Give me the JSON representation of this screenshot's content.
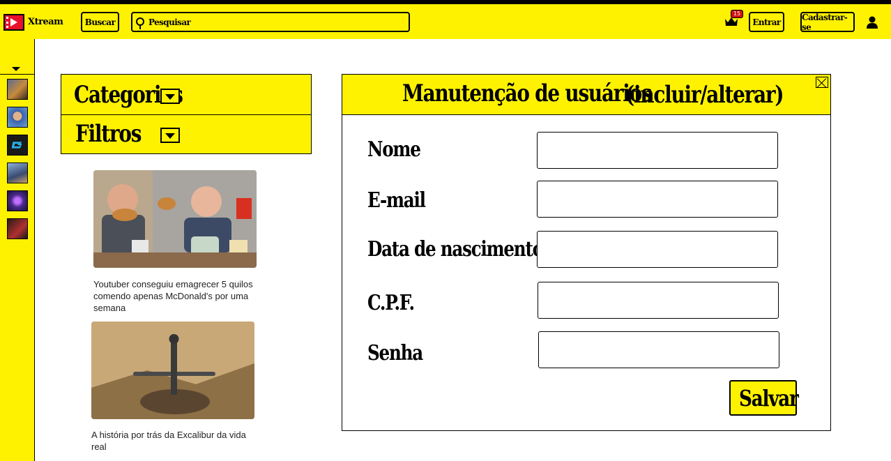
{
  "header": {
    "logo_text": "Xtream",
    "search_button": "Buscar",
    "search_placeholder": "Pesquisar",
    "notification_count": "15",
    "login_button": "Entrar",
    "signup_button": "Cadastrar-se"
  },
  "filters": {
    "categories_label": "Categorias",
    "filters_label": "Filtros"
  },
  "news": [
    {
      "caption": "Youtuber conseguiu emagrecer 5 quilos comendo apenas McDonald's por uma semana"
    },
    {
      "caption": "A história por trás da Excalibur da vida real"
    }
  ],
  "form": {
    "title_main": "Manutenção de usuários",
    "title_sub": "(incluir/alterar)",
    "fields": [
      {
        "label": "Nome",
        "value": ""
      },
      {
        "label": "E-mail",
        "value": ""
      },
      {
        "label": "Data de nascimento",
        "value": ""
      },
      {
        "label": "C.P.F.",
        "value": ""
      },
      {
        "label": "Senha",
        "value": ""
      }
    ],
    "save_button": "Salvar"
  },
  "colors": {
    "brand_yellow": "#fff200",
    "logo_red": "#e8102a",
    "badge_red": "#d01010"
  }
}
